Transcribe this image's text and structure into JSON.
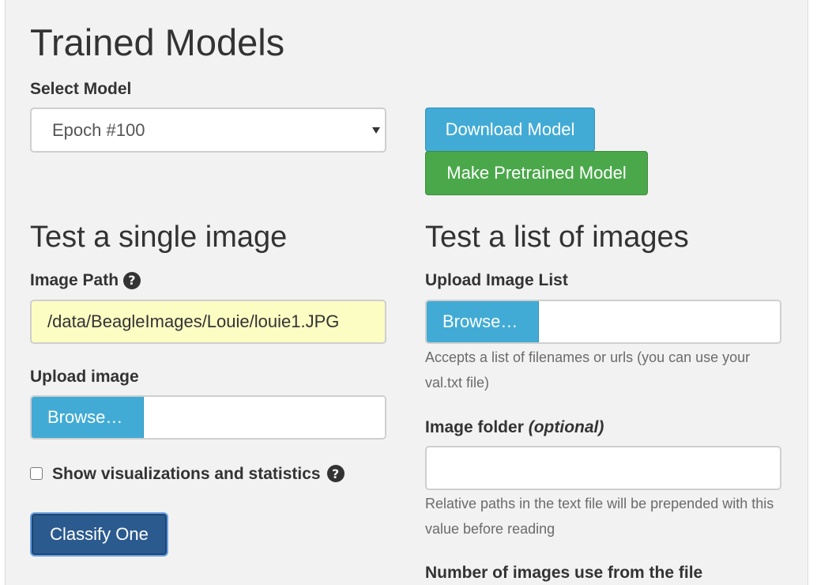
{
  "page": {
    "title": "Trained Models",
    "select_model_label": "Select Model",
    "selected_model": "Epoch #100",
    "download_button": "Download Model",
    "pretrained_button": "Make Pretrained Model"
  },
  "single_image": {
    "heading": "Test a single image",
    "image_path_label": "Image Path",
    "image_path_value": "/data/BeagleImages/Louie/louie1.JPG",
    "upload_label": "Upload image",
    "browse_label": "Browse…",
    "show_visualizations_label": "Show visualizations and statistics",
    "classify_button": "Classify One"
  },
  "image_list": {
    "heading": "Test a list of images",
    "upload_list_label": "Upload Image List",
    "browse_label": "Browse…",
    "upload_list_help": "Accepts a list of filenames or urls (you can use your val.txt file)",
    "image_folder_label": "Image folder",
    "image_folder_optional": "(optional)",
    "image_folder_help": "Relative paths in the text file will be prepended with this value before reading",
    "num_images_label": "Number of images use from the file"
  },
  "icons": {
    "help": "question-circle-icon",
    "select_caret": "caret-down-icon"
  },
  "colors": {
    "info": "#41abd6",
    "success": "#4aa84a",
    "primary": "#2b5a8f",
    "image_path_bg": "#fbfdc3"
  }
}
